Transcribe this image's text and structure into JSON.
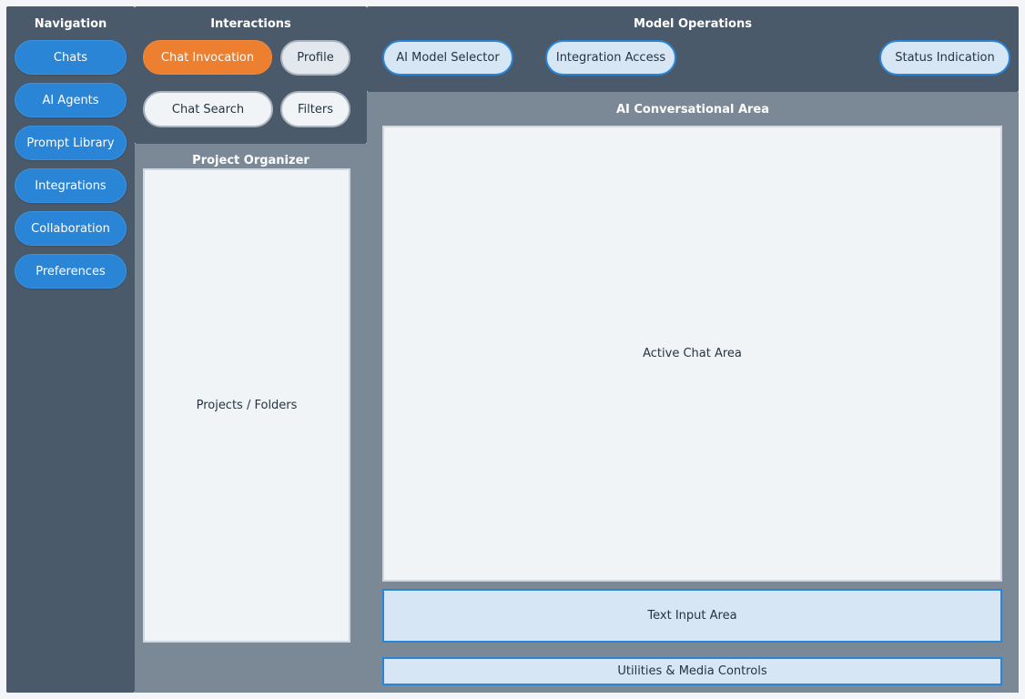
{
  "navigation": {
    "title": "Navigation",
    "items": [
      {
        "label": "Chats"
      },
      {
        "label": "AI Agents"
      },
      {
        "label": "Prompt Library"
      },
      {
        "label": "Integrations"
      },
      {
        "label": "Collaboration"
      },
      {
        "label": "Preferences"
      }
    ]
  },
  "interactions": {
    "title": "Interactions",
    "chat_invocation": "Chat Invocation",
    "profile": "Profile",
    "chat_search": "Chat Search",
    "filters": "Filters"
  },
  "project_organizer": {
    "title": "Project Organizer",
    "content": "Projects / Folders"
  },
  "model_operations": {
    "title": "Model Operations",
    "model_selector": "AI Model Selector",
    "integration_access": "Integration Access",
    "status_indication": "Status Indication"
  },
  "conversational_area": {
    "title": "AI Conversational Area",
    "active_chat": "Active Chat Area",
    "text_input": "Text Input Area",
    "utilities": "Utilities & Media Controls"
  },
  "colors": {
    "accent_blue": "#2a85d6",
    "accent_orange": "#ec7f30",
    "panel_dark": "#4b5a6a",
    "panel_mid": "#7b8997"
  }
}
